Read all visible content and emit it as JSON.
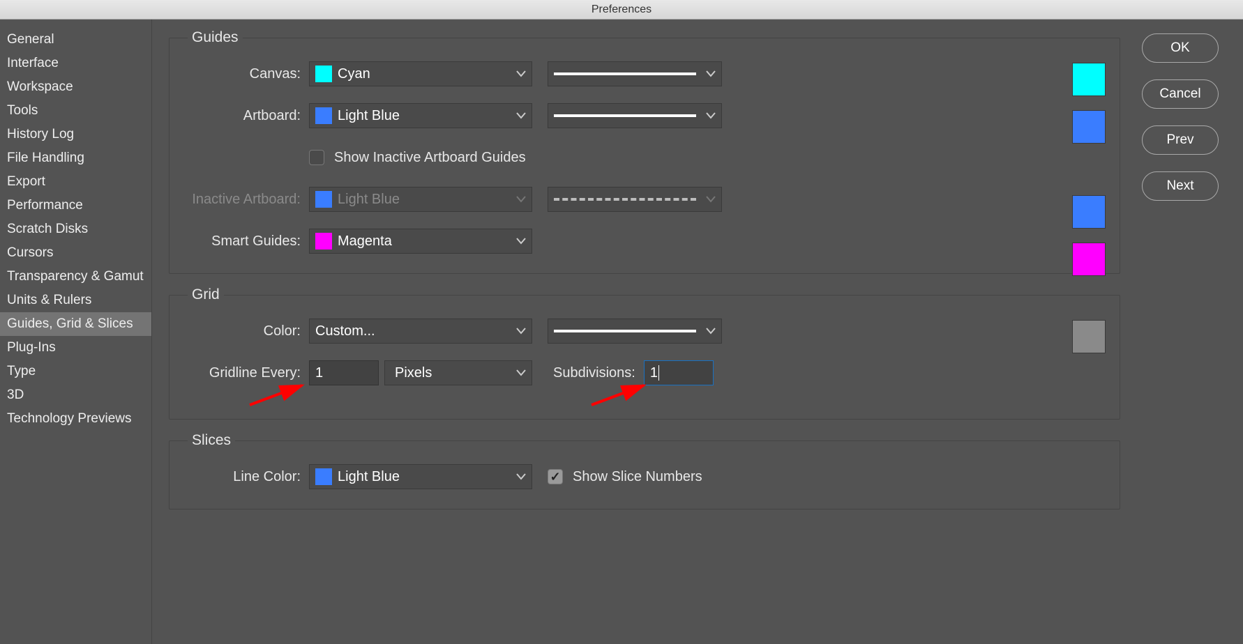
{
  "window": {
    "title": "Preferences"
  },
  "sidebar": {
    "items": [
      {
        "label": "General"
      },
      {
        "label": "Interface"
      },
      {
        "label": "Workspace"
      },
      {
        "label": "Tools"
      },
      {
        "label": "History Log"
      },
      {
        "label": "File Handling"
      },
      {
        "label": "Export"
      },
      {
        "label": "Performance"
      },
      {
        "label": "Scratch Disks"
      },
      {
        "label": "Cursors"
      },
      {
        "label": "Transparency & Gamut"
      },
      {
        "label": "Units & Rulers"
      },
      {
        "label": "Guides, Grid & Slices"
      },
      {
        "label": "Plug-Ins"
      },
      {
        "label": "Type"
      },
      {
        "label": "3D"
      },
      {
        "label": "Technology Previews"
      }
    ],
    "selected_index": 12
  },
  "buttons": {
    "ok": "OK",
    "cancel": "Cancel",
    "prev": "Prev",
    "next": "Next"
  },
  "guides": {
    "title": "Guides",
    "canvas_label": "Canvas:",
    "canvas_color_name": "Cyan",
    "canvas_color": "#00FFFF",
    "artboard_label": "Artboard:",
    "artboard_color_name": "Light Blue",
    "artboard_color": "#3A7DFF",
    "show_inactive_label": "Show Inactive Artboard Guides",
    "show_inactive_checked": false,
    "inactive_label": "Inactive Artboard:",
    "inactive_color_name": "Light Blue",
    "inactive_color": "#3A7DFF",
    "smart_label": "Smart Guides:",
    "smart_color_name": "Magenta",
    "smart_color": "#FF00FF"
  },
  "grid": {
    "title": "Grid",
    "color_label": "Color:",
    "color_name": "Custom...",
    "swatch": "#8a8a8a",
    "gridline_label": "Gridline Every:",
    "gridline_value": "1",
    "gridline_unit": "Pixels",
    "subdivisions_label": "Subdivisions:",
    "subdivisions_value": "1"
  },
  "slices": {
    "title": "Slices",
    "line_color_label": "Line Color:",
    "line_color_name": "Light Blue",
    "line_color": "#3A7DFF",
    "show_numbers_label": "Show Slice Numbers",
    "show_numbers_checked": true
  }
}
